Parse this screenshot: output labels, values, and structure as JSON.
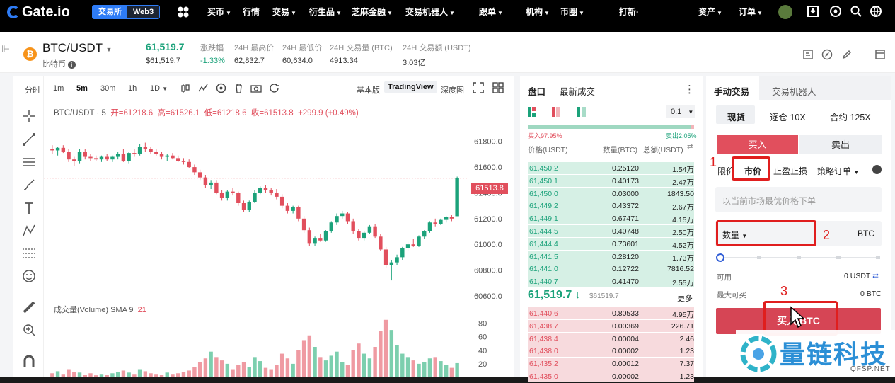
{
  "nav": {
    "logo": "Gate.io",
    "seg_exchange": "交易所",
    "seg_web3": "Web3",
    "items": [
      {
        "label": "买币",
        "caret": true
      },
      {
        "label": "行情",
        "caret": false
      },
      {
        "label": "交易",
        "caret": true
      },
      {
        "label": "衍生品",
        "caret": true
      },
      {
        "label": "芝麻金融",
        "caret": true
      },
      {
        "label": "交易机器人",
        "caret": true
      },
      {
        "label": "跟单",
        "caret": true
      },
      {
        "label": "机构",
        "caret": true
      },
      {
        "label": "币圈",
        "caret": true
      },
      {
        "label": "打新·",
        "caret": false
      },
      {
        "label": "资产",
        "caret": true
      },
      {
        "label": "订单",
        "caret": true
      }
    ]
  },
  "header": {
    "pair": "BTC/USDT",
    "pair_sub": "比特币",
    "last_price": "61,519.7",
    "last_price_usd": "$61,519.7",
    "change_label": "涨跌幅",
    "change_value": "-1.33%",
    "high_label": "24H 最高价",
    "high_value": "62,832.7",
    "low_label": "24H 最低价",
    "low_value": "60,634.0",
    "vol_btc_label": "24H 交易量 (BTC)",
    "vol_btc_value": "4913.34",
    "vol_usdt_label": "24H 交易额 (USDT)",
    "vol_usdt_value": "3.03亿"
  },
  "chart_toolbar": {
    "intervals": [
      "分时",
      "1m",
      "5m",
      "30m",
      "1h",
      "1D"
    ],
    "active_interval": "5m",
    "view_basic": "基本版",
    "view_tradingview": "TradingView",
    "view_depth": "深度图"
  },
  "chart_legend": {
    "symbol": "BTC/USDT · 5",
    "open_label": "开=61218.6",
    "high_label": "高=61526.1",
    "low_label": "低=61218.6",
    "close_label": "收=61513.8",
    "change": "+299.9 (+0.49%)",
    "current_price_tag": "61513.8"
  },
  "price_axis": [
    "61800.0",
    "61600.0",
    "61400.0",
    "61200.0",
    "61000.0",
    "60800.0",
    "60600.0"
  ],
  "volume": {
    "legend": "成交量(Volume) SMA 9",
    "legend_value": "21",
    "axis": [
      "80",
      "60",
      "40",
      "20"
    ]
  },
  "orderbook": {
    "tab_book": "盘口",
    "tab_trades": "最新成交",
    "precision": "0.1",
    "buy_pct": "买入97.95%",
    "sell_pct": "卖出2.05%",
    "col_price": "价格(USDT)",
    "col_amount": "数量(BTC)",
    "col_total": "总额(USDT)",
    "bids": [
      {
        "price": "61,450.2",
        "amount": "0.25120",
        "total": "1.54万"
      },
      {
        "price": "61,450.1",
        "amount": "0.40173",
        "total": "2.47万"
      },
      {
        "price": "61,450.0",
        "amount": "0.03000",
        "total": "1843.50"
      },
      {
        "price": "61,449.2",
        "amount": "0.43372",
        "total": "2.67万"
      },
      {
        "price": "61,449.1",
        "amount": "0.67471",
        "total": "4.15万"
      },
      {
        "price": "61,444.5",
        "amount": "0.40748",
        "total": "2.50万"
      },
      {
        "price": "61,444.4",
        "amount": "0.73601",
        "total": "4.52万"
      },
      {
        "price": "61,441.5",
        "amount": "0.28120",
        "total": "1.73万"
      },
      {
        "price": "61,441.0",
        "amount": "0.12722",
        "total": "7816.52"
      },
      {
        "price": "61,440.7",
        "amount": "0.41470",
        "total": "2.55万"
      }
    ],
    "last_price": "61,519.7 ↓",
    "last_price_usd": "$61519.7",
    "more": "更多",
    "asks": [
      {
        "price": "61,440.6",
        "amount": "0.80533",
        "total": "4.95万"
      },
      {
        "price": "61,438.7",
        "amount": "0.00369",
        "total": "226.71"
      },
      {
        "price": "61,438.4",
        "amount": "0.00004",
        "total": "2.46"
      },
      {
        "price": "61,438.0",
        "amount": "0.00002",
        "total": "1.23"
      },
      {
        "price": "61,435.2",
        "amount": "0.00012",
        "total": "7.37"
      },
      {
        "price": "61,435.0",
        "amount": "0.00002",
        "total": "1.23"
      }
    ]
  },
  "trade": {
    "tab_manual": "手动交易",
    "tab_bot": "交易机器人",
    "mode_spot": "现货",
    "mode_margin": "逐仓 10X",
    "mode_futures": "合约 125X",
    "buy": "买入",
    "sell": "卖出",
    "type_limit": "限价",
    "type_market": "市价",
    "type_tpsl": "止盈止损",
    "type_strategy": "策略订单",
    "market_placeholder": "以当前市场最优价格下单",
    "qty_label": "数量",
    "qty_unit": "BTC",
    "available_label": "可用",
    "available_value": "0 USDT",
    "max_buy_label": "最大可买",
    "max_buy_value": "0 BTC",
    "submit": "买入 BTC"
  },
  "annotations": [
    "1",
    "2",
    "3"
  ],
  "watermark": {
    "text": "量链科技",
    "sub": "QFSP.NET"
  },
  "candles": [
    [
      61740,
      61770,
      61700,
      61730
    ],
    [
      61730,
      61760,
      61690,
      61750
    ],
    [
      61750,
      61770,
      61710,
      61720
    ],
    [
      61720,
      61740,
      61640,
      61660
    ],
    [
      61660,
      61680,
      61610,
      61650
    ],
    [
      61650,
      61740,
      61630,
      61720
    ],
    [
      61720,
      61740,
      61660,
      61680
    ],
    [
      61680,
      61700,
      61650,
      61670
    ],
    [
      61670,
      61690,
      61650,
      61660
    ],
    [
      61660,
      61690,
      61640,
      61680
    ],
    [
      61680,
      61700,
      61650,
      61660
    ],
    [
      61660,
      61690,
      61640,
      61680
    ],
    [
      61680,
      61720,
      61660,
      61700
    ],
    [
      61700,
      61740,
      61640,
      61650
    ],
    [
      61650,
      61720,
      61630,
      61710
    ],
    [
      61710,
      61740,
      61680,
      61700
    ],
    [
      61700,
      61780,
      61690,
      61760
    ],
    [
      61760,
      61790,
      61720,
      61740
    ],
    [
      61740,
      61760,
      61700,
      61720
    ],
    [
      61720,
      61740,
      61690,
      61700
    ],
    [
      61700,
      61720,
      61660,
      61680
    ],
    [
      61680,
      61700,
      61650,
      61690
    ],
    [
      61690,
      61710,
      61660,
      61670
    ],
    [
      61670,
      61690,
      61640,
      61650
    ],
    [
      61650,
      61670,
      61620,
      61640
    ],
    [
      61640,
      61660,
      61590,
      61600
    ],
    [
      61600,
      61620,
      61540,
      61560
    ],
    [
      61560,
      61580,
      61500,
      61520
    ],
    [
      61520,
      61540,
      61440,
      61460
    ],
    [
      61460,
      61500,
      61430,
      61480
    ],
    [
      61480,
      61500,
      61390,
      61400
    ],
    [
      61400,
      61420,
      61340,
      61360
    ],
    [
      61360,
      61420,
      61340,
      61410
    ],
    [
      61410,
      61440,
      61380,
      61400
    ],
    [
      61400,
      61410,
      61300,
      61320
    ],
    [
      61320,
      61340,
      61250,
      61270
    ],
    [
      61270,
      61340,
      61250,
      61330
    ],
    [
      61330,
      61420,
      61320,
      61400
    ],
    [
      61400,
      61450,
      61390,
      61440
    ],
    [
      61440,
      61460,
      61400,
      61420
    ],
    [
      61420,
      61440,
      61380,
      61400
    ],
    [
      61400,
      61430,
      61350,
      61370
    ],
    [
      61370,
      61390,
      61280,
      61300
    ],
    [
      61300,
      61320,
      61240,
      61260
    ],
    [
      61260,
      61300,
      61240,
      61290
    ],
    [
      61290,
      61300,
      61180,
      61200
    ],
    [
      61200,
      61220,
      61090,
      61110
    ],
    [
      61110,
      61130,
      60990,
      61010
    ],
    [
      61010,
      61060,
      60990,
      61050
    ],
    [
      61050,
      61080,
      61020,
      61030
    ],
    [
      61030,
      61110,
      61020,
      61100
    ],
    [
      61100,
      61180,
      61090,
      61170
    ],
    [
      61170,
      61240,
      61150,
      61220
    ],
    [
      61220,
      61260,
      61200,
      61240
    ],
    [
      61240,
      61250,
      61160,
      61180
    ],
    [
      61180,
      61200,
      61080,
      61100
    ],
    [
      61100,
      61120,
      61030,
      61050
    ],
    [
      61050,
      61100,
      61030,
      61090
    ],
    [
      61090,
      61150,
      61080,
      61140
    ],
    [
      61140,
      61160,
      61050,
      61060
    ],
    [
      61060,
      61080,
      60950,
      60960
    ],
    [
      60960,
      60980,
      60820,
      60840
    ],
    [
      60840,
      60880,
      60720,
      60860
    ],
    [
      60860,
      60920,
      60840,
      60900
    ],
    [
      60900,
      60980,
      60880,
      60970
    ],
    [
      60970,
      61020,
      60950,
      61000
    ],
    [
      61000,
      61040,
      60980,
      60990
    ],
    [
      60990,
      61070,
      60980,
      61060
    ],
    [
      61060,
      61110,
      61040,
      61100
    ],
    [
      61100,
      61180,
      61090,
      61170
    ],
    [
      61170,
      61200,
      61140,
      61160
    ],
    [
      61160,
      61200,
      61150,
      61190
    ],
    [
      61190,
      61220,
      61170,
      61210
    ],
    [
      61210,
      61230,
      61180,
      61200
    ],
    [
      61218.6,
      61526.1,
      61218.6,
      61513.8
    ]
  ],
  "volumes": [
    6,
    9,
    5,
    12,
    8,
    7,
    4,
    6,
    3,
    5,
    4,
    6,
    8,
    10,
    7,
    5,
    12,
    9,
    6,
    5,
    4,
    7,
    5,
    6,
    8,
    10,
    15,
    22,
    28,
    38,
    30,
    25,
    20,
    12,
    18,
    22,
    15,
    30,
    24,
    14,
    12,
    18,
    35,
    28,
    20,
    40,
    55,
    62,
    45,
    30,
    25,
    32,
    38,
    22,
    18,
    40,
    50,
    35,
    28,
    45,
    68,
    85,
    70,
    48,
    35,
    30,
    25,
    20,
    22,
    28,
    30,
    24,
    18,
    14,
    21
  ]
}
